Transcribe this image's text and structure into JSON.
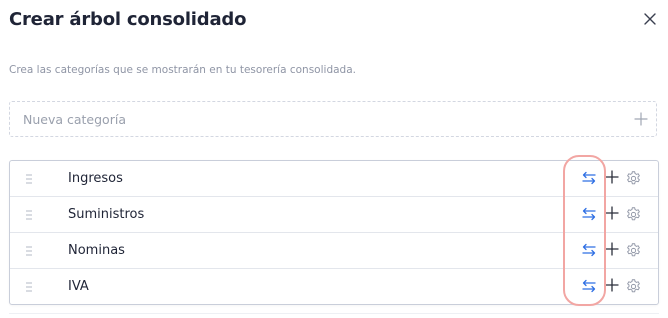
{
  "modal": {
    "title": "Crear árbol consolidado",
    "subtitle": "Crea las categorías que se mostrarán en tu tesorería consolidada."
  },
  "new_category": {
    "placeholder": "Nueva categoría",
    "value": ""
  },
  "categories": [
    {
      "label": "Ingresos"
    },
    {
      "label": "Suministros"
    },
    {
      "label": "Nominas"
    },
    {
      "label": "IVA"
    }
  ],
  "icons": {
    "close": "close-icon",
    "add": "plus-icon",
    "drag": "drag-handle-icon",
    "swap": "swap-arrows-icon",
    "settings": "gear-icon"
  },
  "colors": {
    "title": "#1f2436",
    "accent_blue": "#2f6fe4",
    "highlight": "#f2a6a3",
    "muted": "#8f95a5"
  }
}
